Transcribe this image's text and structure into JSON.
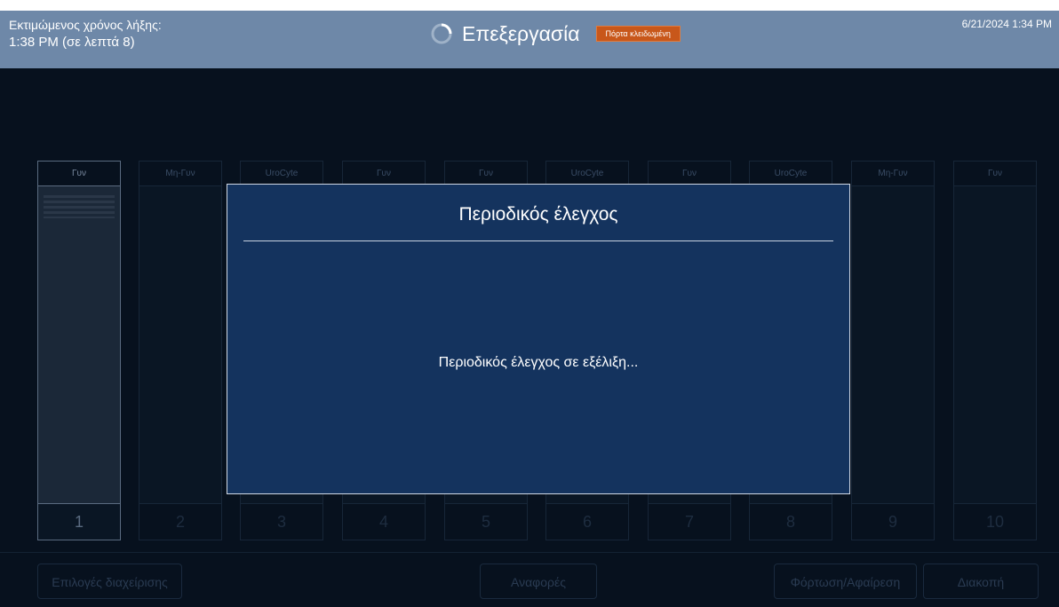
{
  "header": {
    "eta_label": "Εκτιμώμενος χρόνος λήξης:",
    "eta_value": "1:38 PM (σε λεπτά 8)",
    "status_title": "Επεξεργασία",
    "door_badge": "Πόρτα κλειδωμένη",
    "datetime": "6/21/2024 1:34 PM",
    "spinner_icon": "loading-spinner-icon"
  },
  "slots": [
    {
      "label": "Γυν",
      "number": "1"
    },
    {
      "label": "Μη-Γυν",
      "number": "2"
    },
    {
      "label": "UroCyte",
      "number": "3"
    },
    {
      "label": "Γυν",
      "number": "4"
    },
    {
      "label": "Γυν",
      "number": "5"
    },
    {
      "label": "UroCyte",
      "number": "6"
    },
    {
      "label": "Γυν",
      "number": "7"
    },
    {
      "label": "UroCyte",
      "number": "8"
    },
    {
      "label": "Μη-Γυν",
      "number": "9"
    },
    {
      "label": "Γυν",
      "number": "10"
    }
  ],
  "footer": {
    "admin_options": "Επιλογές διαχείρισης",
    "reports": "Αναφορές",
    "load_unload": "Φόρτωση/Αφαίρεση",
    "pause": "Διακοπή"
  },
  "modal": {
    "title": "Περιοδικός έλεγχος",
    "message": "Περιοδικός έλεγχος σε εξέλιξη..."
  },
  "colors": {
    "header_bg": "#6e88a8",
    "badge": "#c8571a",
    "modal_bg": "#14335e"
  }
}
